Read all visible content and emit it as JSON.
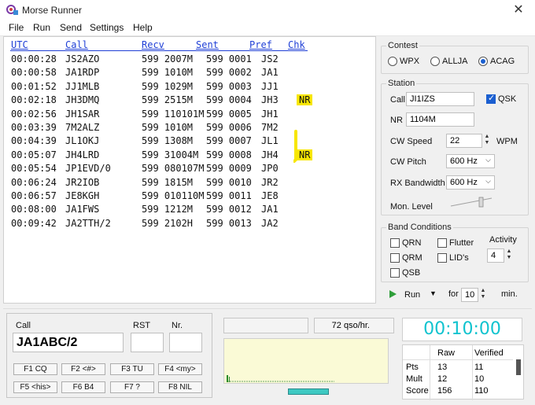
{
  "window": {
    "title": "Morse Runner"
  },
  "menu": [
    "File",
    "Run",
    "Send",
    "Settings",
    "Help"
  ],
  "log": {
    "headers": [
      "UTC",
      "Call",
      "Recv",
      "Sent",
      "Pref",
      "Chk"
    ],
    "rows": [
      {
        "utc": "00:00:28",
        "call": "JS2AZO",
        "recv": "599 2007M",
        "sent": "599 0001",
        "pref": "JS2",
        "chk": ""
      },
      {
        "utc": "00:00:58",
        "call": "JA1RDP",
        "recv": "599 1010M",
        "sent": "599 0002",
        "pref": "JA1",
        "chk": ""
      },
      {
        "utc": "00:01:52",
        "call": "JJ1MLB",
        "recv": "599 1029M",
        "sent": "599 0003",
        "pref": "JJ1",
        "chk": ""
      },
      {
        "utc": "00:02:18",
        "call": "JH3DMQ",
        "recv": "599 2515M",
        "sent": "599 0004",
        "pref": "JH3",
        "chk": "NR"
      },
      {
        "utc": "00:02:56",
        "call": "JH1SAR",
        "recv": "599 110101M",
        "sent": "599 0005",
        "pref": "JH1",
        "chk": ""
      },
      {
        "utc": "00:03:39",
        "call": "7M2ALZ",
        "recv": "599 1010M",
        "sent": "599 0006",
        "pref": "7M2",
        "chk": ""
      },
      {
        "utc": "00:04:39",
        "call": "JL1OKJ",
        "recv": "599 1308M",
        "sent": "599 0007",
        "pref": "JL1",
        "chk": ""
      },
      {
        "utc": "00:05:07",
        "call": "JH4LRD",
        "recv": "599 31004M",
        "sent": "599 0008",
        "pref": "JH4",
        "chk": "NR"
      },
      {
        "utc": "00:05:54",
        "call": "JP1EVD/0",
        "recv": "599 080107M",
        "sent": "599 0009",
        "pref": "JP0",
        "chk": ""
      },
      {
        "utc": "00:06:24",
        "call": "JR2IOB",
        "recv": "599 1815M",
        "sent": "599 0010",
        "pref": "JR2",
        "chk": ""
      },
      {
        "utc": "00:06:57",
        "call": "JE8KGH",
        "recv": "599 010110M",
        "sent": "599 0011",
        "pref": "JE8",
        "chk": ""
      },
      {
        "utc": "00:08:00",
        "call": "JA1FWS",
        "recv": "599 1212M",
        "sent": "599 0012",
        "pref": "JA1",
        "chk": ""
      },
      {
        "utc": "00:09:42",
        "call": "JA2TTH/2",
        "recv": "599 2102H",
        "sent": "599 0013",
        "pref": "JA2",
        "chk": ""
      }
    ]
  },
  "contest": {
    "title": "Contest",
    "options": [
      "WPX",
      "ALLJA",
      "ACAG"
    ],
    "selected": "ACAG"
  },
  "station": {
    "title": "Station",
    "call_label": "Call",
    "call_value": "JI1IZS",
    "qsk_label": "QSK",
    "qsk_checked": true,
    "nr_label": "NR",
    "nr_value": "1104M",
    "cw_speed_label": "CW Speed",
    "cw_speed_value": "22",
    "wpm_label": "WPM",
    "cw_pitch_label": "CW Pitch",
    "cw_pitch_value": "600 Hz",
    "rx_bw_label": "RX Bandwidth",
    "rx_bw_value": "600 Hz",
    "mon_level_label": "Mon. Level"
  },
  "band": {
    "title": "Band Conditions",
    "qrn": "QRN",
    "qrm": "QRM",
    "qsb": "QSB",
    "flutter": "Flutter",
    "lids": "LID's",
    "activity_label": "Activity",
    "activity_value": "4"
  },
  "run": {
    "label": "Run",
    "for_label": "for",
    "minutes": "10",
    "min_label": "min."
  },
  "entry": {
    "call_label": "Call",
    "call_value": "JA1ABC/2",
    "rst_label": "RST",
    "rst_value": "",
    "nr_label": "Nr.",
    "nr_value": ""
  },
  "fkeys": [
    "F1 CQ",
    "F2 <#>",
    "F3 TU",
    "F4 <my>",
    "F5 <his>",
    "F6 B4",
    "F7 ?",
    "F8 NIL"
  ],
  "status": {
    "rate": "72 qso/hr."
  },
  "timer": "00:10:00",
  "score": {
    "headers": [
      "Raw",
      "Verified"
    ],
    "rows": [
      {
        "label": "Pts",
        "raw": "13",
        "verified": "11"
      },
      {
        "label": "Mult",
        "raw": "12",
        "verified": "10"
      },
      {
        "label": "Score",
        "raw": "156",
        "verified": "110"
      }
    ]
  },
  "colors": {
    "accent": "#1b5fd0",
    "timer": "#10c3cf",
    "log_header": "#1f3fd6",
    "check_highlight": "#f7e600"
  }
}
